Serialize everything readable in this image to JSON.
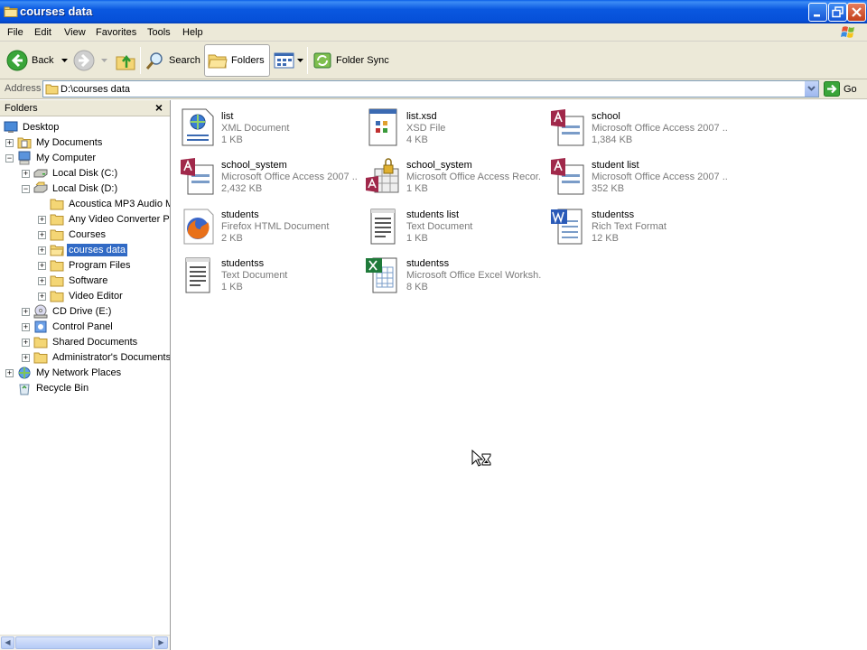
{
  "window": {
    "title": "courses data"
  },
  "menu": [
    "File",
    "Edit",
    "View",
    "Favorites",
    "Tools",
    "Help"
  ],
  "toolbar": {
    "back": "Back",
    "search": "Search",
    "folders": "Folders",
    "folder_sync": "Folder Sync"
  },
  "address": {
    "label": "Address",
    "value": "D:\\courses data",
    "go": "Go"
  },
  "folders_pane": {
    "title": "Folders",
    "close": "×",
    "tree": [
      "Desktop",
      "My Documents",
      "My Computer",
      "Local Disk (C:)",
      "Local Disk (D:)",
      "Acoustica MP3 Audio Mixer",
      "Any Video Converter Pro",
      "Courses",
      "courses data",
      "Program Files",
      "Software",
      "Video Editor",
      "CD Drive (E:)",
      "Control Panel",
      "Shared Documents",
      "Administrator's Documents",
      "My Network Places",
      "Recycle Bin"
    ]
  },
  "files": [
    {
      "name": "list",
      "type": "XML Document",
      "size": "1 KB",
      "icon": "xml-document-icon"
    },
    {
      "name": "list.xsd",
      "type": "XSD File",
      "size": "4 KB",
      "icon": "xsd-file-icon"
    },
    {
      "name": "school",
      "type": "Microsoft Office Access 2007 ...",
      "size": "1,384 KB",
      "icon": "access-database-icon"
    },
    {
      "name": "school_system",
      "type": "Microsoft Office Access 2007 ...",
      "size": "2,432 KB",
      "icon": "access-database-icon"
    },
    {
      "name": "school_system",
      "type": "Microsoft Office Access Recor...",
      "size": "1 KB",
      "icon": "access-lock-icon"
    },
    {
      "name": "student list",
      "type": "Microsoft Office Access 2007 ...",
      "size": "352 KB",
      "icon": "access-database-icon"
    },
    {
      "name": "students",
      "type": "Firefox HTML Document",
      "size": "2 KB",
      "icon": "firefox-html-icon"
    },
    {
      "name": "students list",
      "type": "Text Document",
      "size": "1 KB",
      "icon": "text-document-icon"
    },
    {
      "name": "studentss",
      "type": "Rich Text Format",
      "size": "12 KB",
      "icon": "word-rtf-icon"
    },
    {
      "name": "studentss",
      "type": "Text Document",
      "size": "1 KB",
      "icon": "text-document-icon"
    },
    {
      "name": "studentss",
      "type": "Microsoft Office Excel Worksh...",
      "size": "8 KB",
      "icon": "excel-worksheet-icon"
    }
  ],
  "colors": {
    "titlebar": "#0a58e0",
    "selection": "#316ac5",
    "chrome": "#ece9d8"
  }
}
